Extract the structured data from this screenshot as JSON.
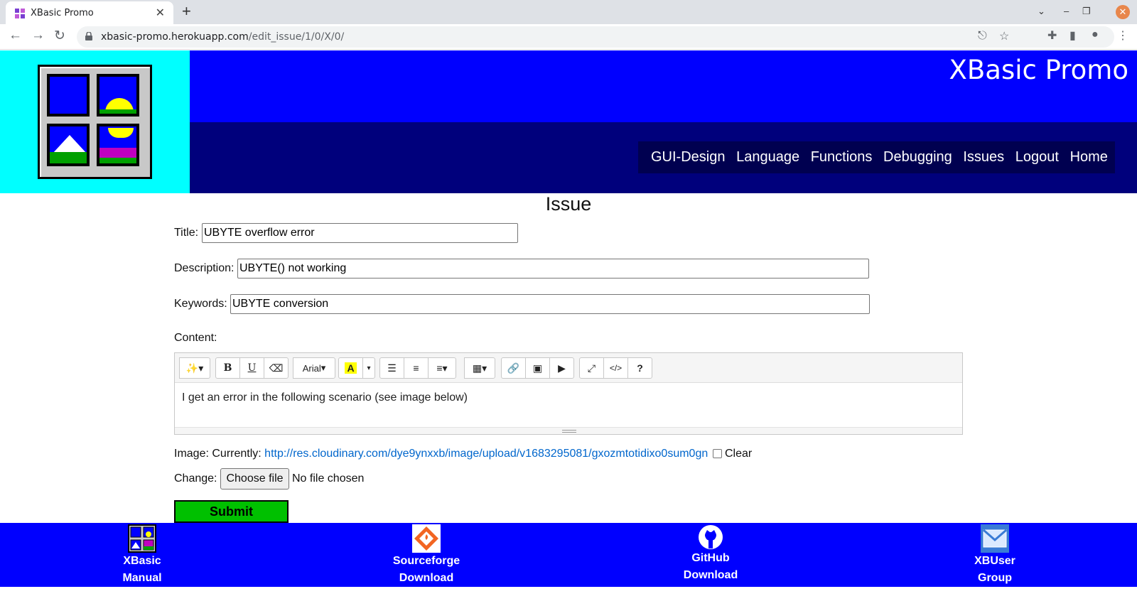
{
  "browser": {
    "tab_title": "XBasic Promo",
    "url_host": "xbasic-promo.herokuapp.com",
    "url_path": "/edit_issue/1/0/X/0/"
  },
  "header": {
    "site_title": "XBasic Promo",
    "nav": [
      "GUI-Design",
      "Language",
      "Functions",
      "Debugging",
      "Issues",
      "Logout",
      "Home"
    ]
  },
  "form": {
    "heading": "Issue",
    "title_label": "Title:",
    "title_value": "UBYTE overflow error",
    "description_label": "Description:",
    "description_value": "UBYTE() not working",
    "keywords_label": "Keywords:",
    "keywords_value": "UBYTE conversion",
    "content_label": "Content:",
    "editor": {
      "font_name": "Arial",
      "body_text": "I get an error in the following scenario (see image below)"
    },
    "image_label": "Image: Currently:",
    "image_url": "http://res.cloudinary.com/dye9ynxxb/image/upload/v1683295081/gxozmtotidixo0sum0gn",
    "clear_label": "Clear",
    "change_label": "Change:",
    "choose_file_label": "Choose file",
    "no_file_text": "No file chosen",
    "submit_label": "Submit"
  },
  "footer": {
    "items": [
      {
        "line1": "XBasic",
        "line2": "Manual"
      },
      {
        "line1": "Sourceforge",
        "line2": "Download"
      },
      {
        "line1": "GitHub",
        "line2": "Download"
      },
      {
        "line1": "XBUser",
        "line2": "Group"
      }
    ]
  },
  "colors": {
    "header_blue": "#0000ff",
    "header_dark": "#00007c",
    "logo_bg": "#00ffff",
    "submit_green": "#00c000",
    "link_blue": "#0066cc"
  }
}
